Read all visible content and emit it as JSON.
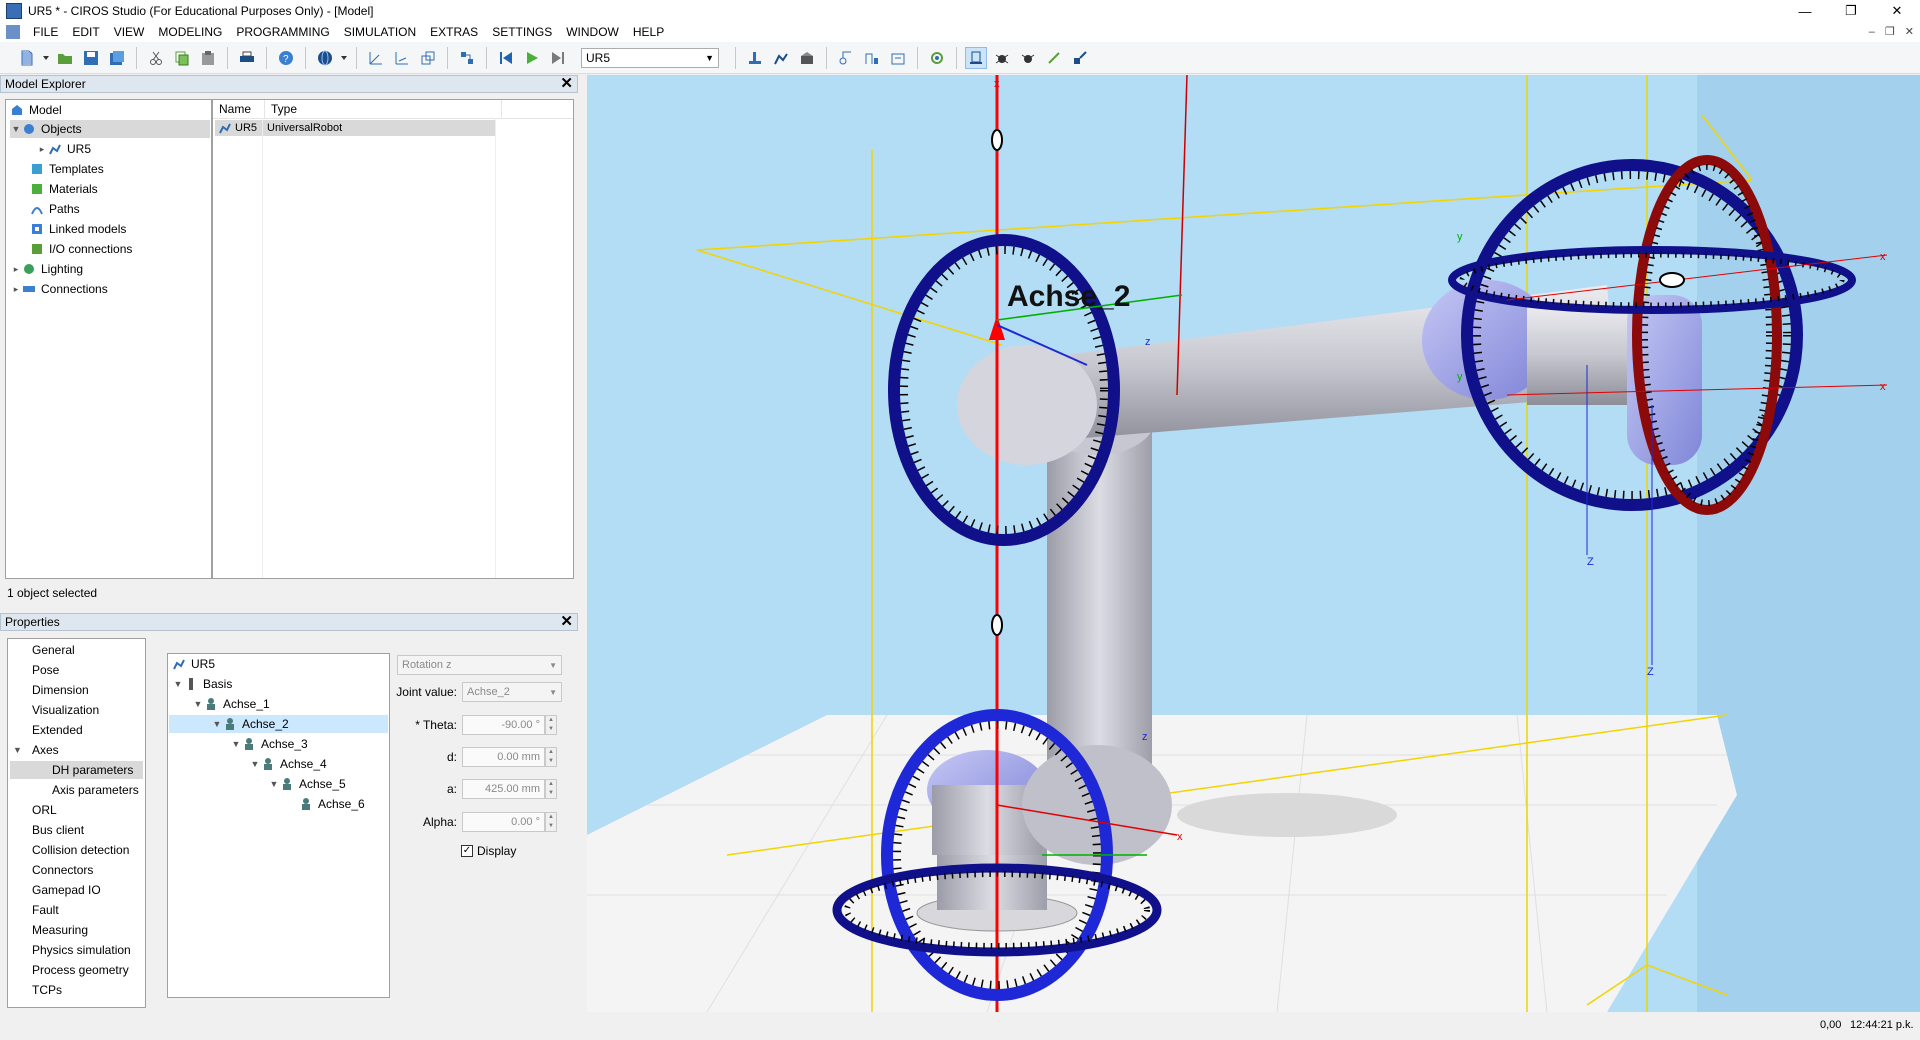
{
  "window": {
    "title": "UR5 * - CIROS Studio (For Educational Purposes Only) - [Model]"
  },
  "menu": [
    "FILE",
    "EDIT",
    "VIEW",
    "MODELING",
    "PROGRAMMING",
    "SIMULATION",
    "EXTRAS",
    "SETTINGS",
    "WINDOW",
    "HELP"
  ],
  "toolbar": {
    "robot_select": "UR5"
  },
  "model_explorer": {
    "title": "Model Explorer",
    "tree": [
      {
        "label": "Model",
        "icon": "model-icon"
      },
      {
        "label": "Objects",
        "icon": "objects-icon"
      },
      {
        "label": "UR5",
        "icon": "robot-icon"
      },
      {
        "label": "Templates",
        "icon": "templates-icon"
      },
      {
        "label": "Materials",
        "icon": "materials-icon"
      },
      {
        "label": "Paths",
        "icon": "paths-icon"
      },
      {
        "label": "Linked models",
        "icon": "linked-models-icon"
      },
      {
        "label": "I/O connections",
        "icon": "io-connections-icon"
      },
      {
        "label": "Lighting",
        "icon": "lighting-icon"
      },
      {
        "label": "Connections",
        "icon": "connections-icon"
      }
    ],
    "list": {
      "columns": [
        "Name",
        "Type"
      ],
      "rows": [
        {
          "name": "UR5",
          "type": "UniversalRobot"
        }
      ]
    },
    "status": "1 object selected"
  },
  "properties": {
    "title": "Properties",
    "categories": [
      "General",
      "Pose",
      "Dimension",
      "Visualization",
      "Extended",
      "Axes",
      "DH parameters",
      "Axis parameters",
      "ORL",
      "Bus client",
      "Collision detection",
      "Connectors",
      "Gamepad IO",
      "Fault",
      "Measuring",
      "Physics simulation",
      "Process geometry",
      "TCPs"
    ],
    "axes_tree": [
      "UR5",
      "Basis",
      "Achse_1",
      "Achse_2",
      "Achse_3",
      "Achse_4",
      "Achse_5",
      "Achse_6"
    ],
    "rotation_select": "Rotation z",
    "joint_value_label": "Joint value:",
    "joint_value": "Achse_2",
    "theta_label": "* Theta:",
    "theta": "-90.00 °",
    "d_label": "d:",
    "d": "0.00 mm",
    "a_label": "a:",
    "a": "425.00 mm",
    "alpha_label": "Alpha:",
    "alpha": "0.00 °",
    "display_label": "Display"
  },
  "viewport": {
    "axis_label": "Achse_2",
    "colors": {
      "sky": "#b3dcf5",
      "floor": "#f4f4f4",
      "ring": "#10108a",
      "ring_red": "#8c0a0a",
      "axis_red": "#ff0000",
      "guide": "#f2d400"
    }
  },
  "statusbar": {
    "coords": "0,00",
    "time": "12:44:21 p.k."
  }
}
